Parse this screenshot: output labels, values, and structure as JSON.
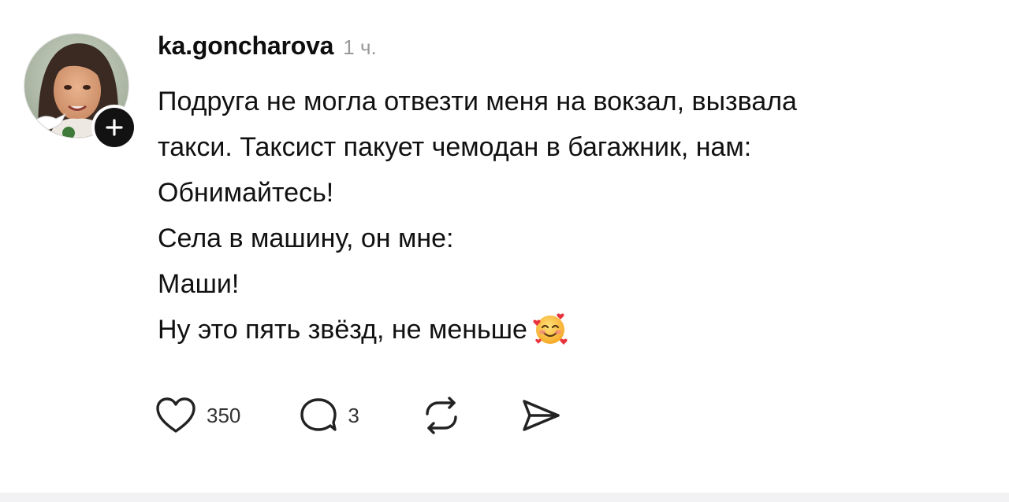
{
  "post": {
    "username": "ka.goncharova",
    "timestamp": "1 ч.",
    "paragraphs": [
      "Подруга не могла отвезти меня на вокзал, вызвала",
      "такси. Таксист пакует чемодан в багажник, нам:",
      "Обнимайтесь!",
      "Села в машину, он мне:",
      "Маши!",
      "Ну это пять звёзд, не меньше"
    ],
    "trailing_emoji": "smiling-face-with-hearts-emoji"
  },
  "actions": {
    "like_count": "350",
    "reply_count": "3"
  },
  "icons": {
    "like": "heart-icon",
    "reply": "speech-bubble-icon",
    "repost": "repost-icon",
    "share": "paper-plane-icon",
    "follow": "plus-icon"
  },
  "colors": {
    "text": "#111111",
    "muted": "#9a9a9a",
    "badge": "#121212",
    "background": "#ffffff"
  }
}
